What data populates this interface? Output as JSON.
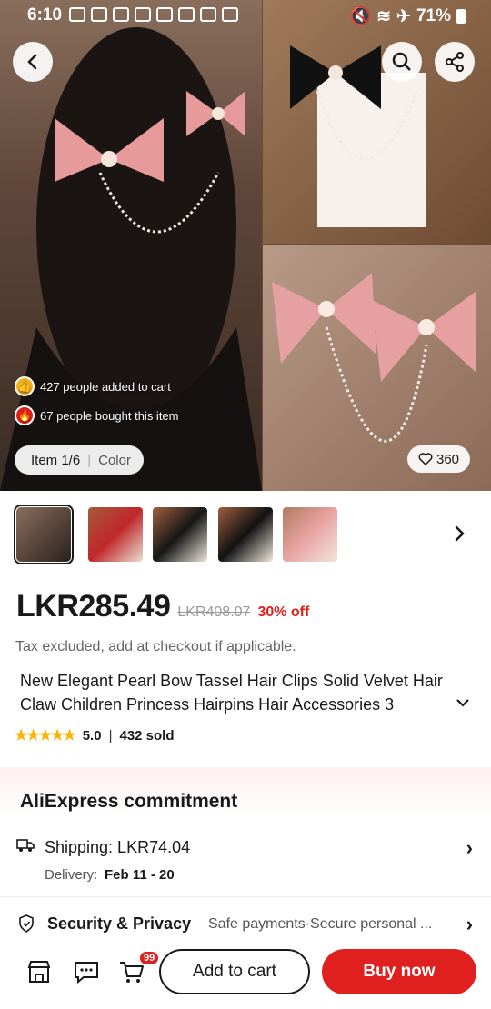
{
  "status_bar": {
    "time": "6:10",
    "battery": "71%"
  },
  "gallery": {
    "social_proof": [
      "427 people added to cart",
      "67 people bought this item"
    ],
    "item_counter": "Item 1/6",
    "variant_label": "Color",
    "wishlist_count": "360"
  },
  "product": {
    "price": "LKR285.49",
    "original_price": "LKR408.07",
    "discount": "30% off",
    "tax_note": "Tax excluded, add at checkout if applicable.",
    "title": "New Elegant Pearl Bow Tassel Hair Clips Solid Velvet Hair Claw Children Princess Hairpins Hair Accessories 3",
    "rating": "5.0",
    "sold": "432 sold"
  },
  "commitment": {
    "heading": "AliExpress commitment",
    "shipping": "Shipping: LKR74.04",
    "delivery_label": "Delivery:",
    "delivery_dates": "Feb 11 - 20",
    "security_title": "Security & Privacy",
    "security_desc": "Safe payments·Secure personal ..."
  },
  "bottom_bar": {
    "cart_badge": "99",
    "add_to_cart": "Add to cart",
    "buy_now": "Buy now"
  },
  "colors": {
    "accent": "#e0201f",
    "star": "#fbb400"
  }
}
